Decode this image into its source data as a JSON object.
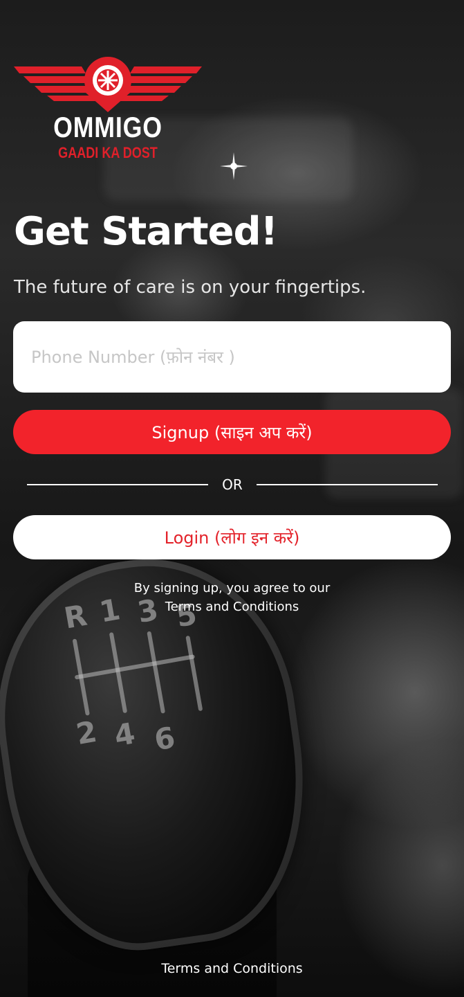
{
  "brand": {
    "name": "OMMIGO",
    "tagline": "GAADI KA DOST",
    "logo_icon": "winged-wheel-icon",
    "primary_color": "#f2232b",
    "logo_red": "#e0202a"
  },
  "hero": {
    "headline": "Get Started!",
    "subtitle": "The future of care is on your fingertips."
  },
  "phone_field": {
    "placeholder": "Phone Number (फ़ोन नंबर )",
    "value": ""
  },
  "actions": {
    "signup_label": "Signup (साइन अप करें)",
    "divider_label": "OR",
    "login_label": "Login (लोग इन करें)"
  },
  "legal": {
    "agree_text": "By signing up, you agree to our",
    "terms_link": "Terms and Conditions",
    "footer_terms": "Terms and Conditions"
  },
  "background": {
    "gear_labels": [
      "R",
      "1",
      "3",
      "5",
      "2",
      "4",
      "6"
    ]
  }
}
